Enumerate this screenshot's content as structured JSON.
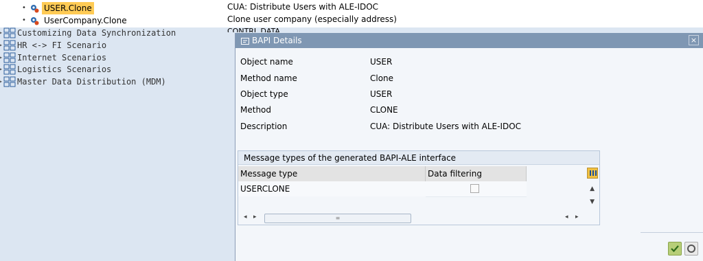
{
  "tree": {
    "items": [
      {
        "label": "USER.Clone",
        "description": "CUA: Distribute Users with ALE-IDOC",
        "selected": true
      },
      {
        "label": "UserCompany.Clone",
        "description": "Clone user company (especially address)",
        "selected": false
      }
    ],
    "partial_text": "CONTRL DATA",
    "groups": [
      {
        "label": "Customizing Data Synchronization"
      },
      {
        "label": "HR <-> FI Scenario"
      },
      {
        "label": "Internet Scenarios"
      },
      {
        "label": "Logistics Scenarios"
      },
      {
        "label": "Master Data Distribution (MDM)"
      }
    ]
  },
  "dialog": {
    "title": "BAPI Details",
    "close_label": "×",
    "fields": [
      {
        "label": "Object name",
        "value": "USER"
      },
      {
        "label": "Method name",
        "value": "Clone"
      },
      {
        "label": "Object type",
        "value": "USER"
      },
      {
        "label": "Method",
        "value": "CLONE"
      },
      {
        "label": "Description",
        "value": "CUA: Distribute Users with ALE-IDOC"
      }
    ],
    "grid": {
      "title": "Message types of the generated BAPI-ALE interface",
      "columns": [
        "Message type",
        "Data filtering"
      ],
      "rows": [
        {
          "message_type": "USERCLONE",
          "data_filtering": false
        }
      ]
    }
  },
  "colors": {
    "selection": "#ffcb55",
    "dialog_title_bg": "#7f97b3",
    "ok_button": "#b7ce78"
  }
}
